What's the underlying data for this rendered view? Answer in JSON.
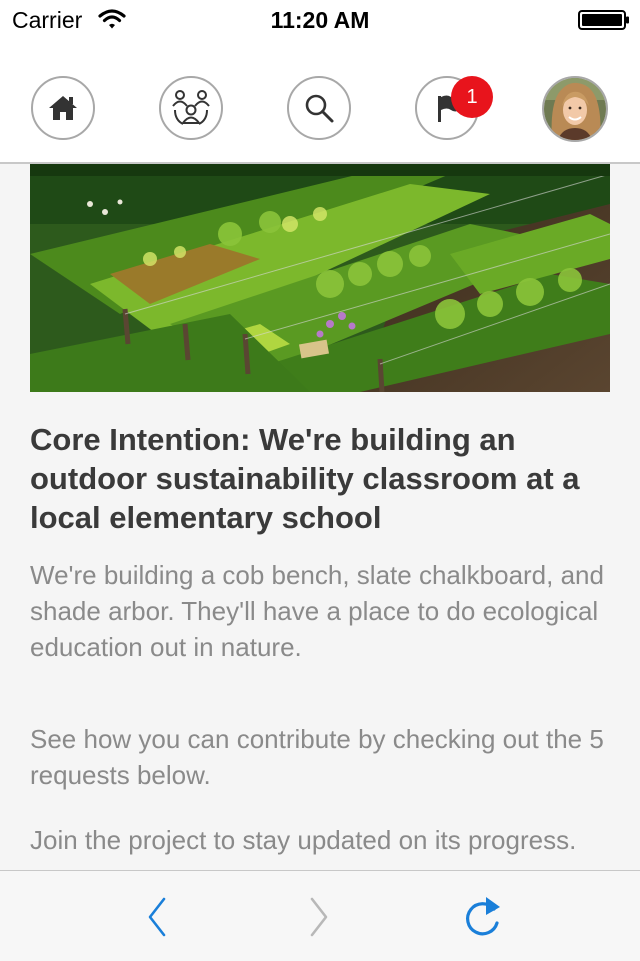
{
  "status_bar": {
    "carrier": "Carrier",
    "time": "11:20 AM"
  },
  "nav": {
    "items": [
      {
        "icon": "home-icon"
      },
      {
        "icon": "community-icon"
      },
      {
        "icon": "search-icon"
      },
      {
        "icon": "flag-icon",
        "badge": "1"
      },
      {
        "icon": "avatar"
      }
    ],
    "badge_color": "#e8141c"
  },
  "project": {
    "title": "Core Intention: We're building an outdoor sustainability classroom at a local elementary school",
    "paragraphs": [
      "We're building a cob bench, slate chalkboard, and shade arbor. They'll have a place to do ecological education out in nature.",
      "See how you can contribute by checking out the 5 requests below.",
      "Join the project to stay updated on its progress."
    ]
  },
  "browser_bar": {
    "items": [
      "back-icon",
      "forward-icon",
      "reload-icon"
    ],
    "accent": "#1a7fd9",
    "disabled": "#b8b8b8"
  }
}
